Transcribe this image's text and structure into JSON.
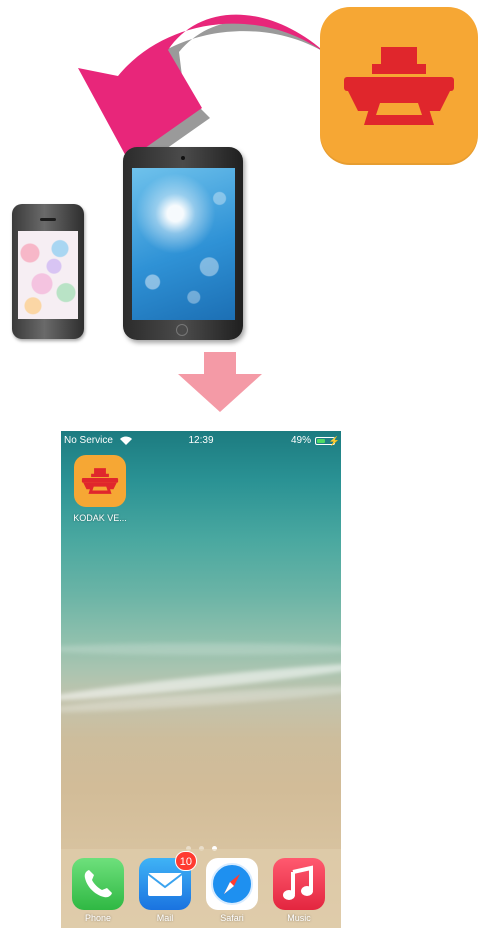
{
  "status_bar": {
    "carrier": "No Service",
    "time": "12:39",
    "battery_percent": "49%",
    "battery_level": 0.49,
    "battery_color": "#4cd964"
  },
  "home_apps": [
    {
      "label": "KODAK VE...",
      "icon": "kodak-printer-icon",
      "color": "#f6a734"
    }
  ],
  "page_indicator": {
    "pages": 3,
    "current": 3
  },
  "dock": {
    "apps": [
      {
        "label": "Phone",
        "icon": "phone-icon"
      },
      {
        "label": "Mail",
        "icon": "mail-icon",
        "badge": "10"
      },
      {
        "label": "Safari",
        "icon": "compass-icon"
      },
      {
        "label": "Music",
        "icon": "music-note-icon"
      }
    ]
  },
  "colors": {
    "accent_arrow": "#e8267a",
    "down_arrow": "#f49aa6",
    "app_orange": "#f6a734",
    "printer_red": "#e0262c"
  }
}
